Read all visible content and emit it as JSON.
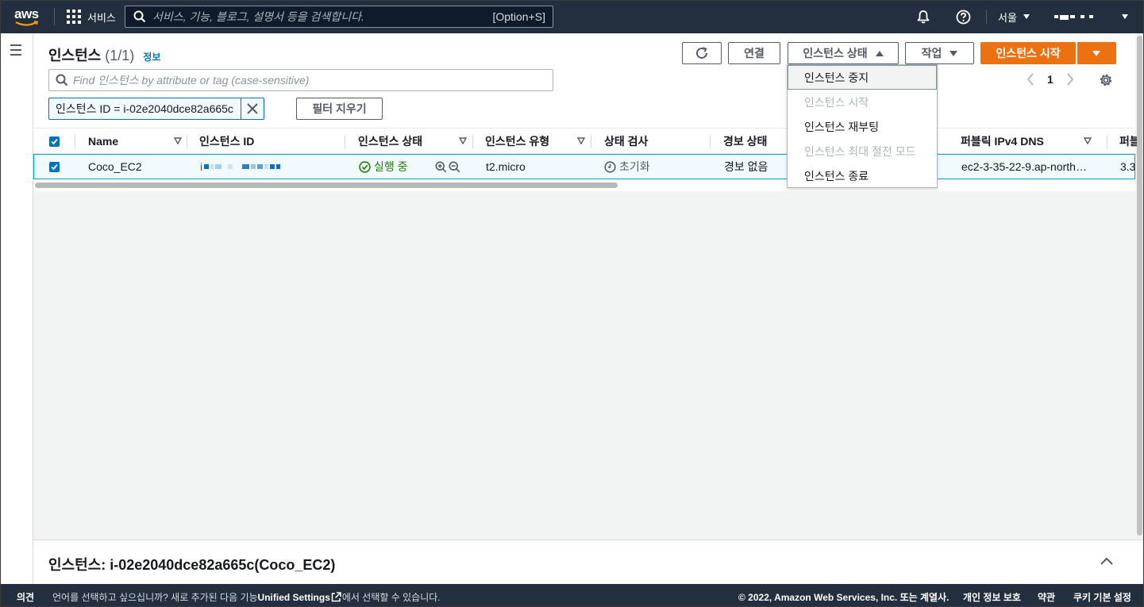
{
  "topnav": {
    "logo_text": "aws",
    "services_label": "서비스",
    "search_placeholder": "서비스, 기능, 블로그, 설명서 등을 검색합니다.",
    "search_shortcut": "[Option+S]",
    "region": "서울"
  },
  "header": {
    "title": "인스턴스",
    "count": "(1/1)",
    "info_link": "정보"
  },
  "toolbar": {
    "connect_label": "연결",
    "instance_state_label": "인스턴스 상태",
    "actions_label": "작업",
    "launch_label": "인스턴스 시작"
  },
  "filter": {
    "placeholder": "Find 인스턴스 by attribute or tag (case-sensitive)",
    "token": "인스턴스 ID = i-02e2040dce82a665c",
    "clear_label": "필터 지우기"
  },
  "pagination": {
    "page": "1"
  },
  "table": {
    "columns": [
      "Name",
      "인스턴스 ID",
      "인스턴스 상태",
      "인스턴스 유형",
      "상태 검사",
      "경보 상태",
      "퍼블릭 IPv4 DNS",
      "퍼블"
    ],
    "rows": [
      {
        "name": "Coco_EC2",
        "instance_id_prefix": "i",
        "state": "실행 중",
        "type": "t2.micro",
        "status_check": "초기화",
        "alarm_status": "경보 없음",
        "public_dns": "ec2-3-35-22-9.ap-north…",
        "public_ip": "3.3"
      }
    ]
  },
  "state_menu": {
    "items": [
      {
        "label": "인스턴스 중지",
        "enabled": true
      },
      {
        "label": "인스턴스 시작",
        "enabled": false
      },
      {
        "label": "인스턴스 재부팅",
        "enabled": true
      },
      {
        "label": "인스턴스 최대 절전 모드",
        "enabled": false
      },
      {
        "label": "인스턴스 종료",
        "enabled": true
      }
    ]
  },
  "details": {
    "title": "인스턴스: i-02e2040dce82a665c(Coco_EC2)"
  },
  "footer": {
    "feedback": "의견",
    "language_prefix": "언어를 선택하고 싶으십니까? 새로 추가된 다음 기능",
    "unified_settings": "Unified Settings",
    "language_suffix": "에서 선택할 수 있습니다.",
    "copyright": "© 2022, Amazon Web Services, Inc. 또는 계열사.",
    "privacy": "개인 정보 보호",
    "terms": "약관",
    "cookies": "쿠키 기본 설정"
  },
  "colors": {
    "nav_bg": "#232f3e",
    "accent_orange": "#ec7211",
    "link_blue": "#0073bb",
    "running_green": "#1d8102",
    "selected_row_bg": "#f1faff"
  },
  "icons": [
    "hamburger-icon",
    "refresh-icon",
    "search-icon",
    "bell-icon",
    "help-icon",
    "settings-icon",
    "check-circle-icon",
    "clock-icon",
    "zoom-in-icon",
    "zoom-out-icon",
    "external-link-icon"
  ]
}
